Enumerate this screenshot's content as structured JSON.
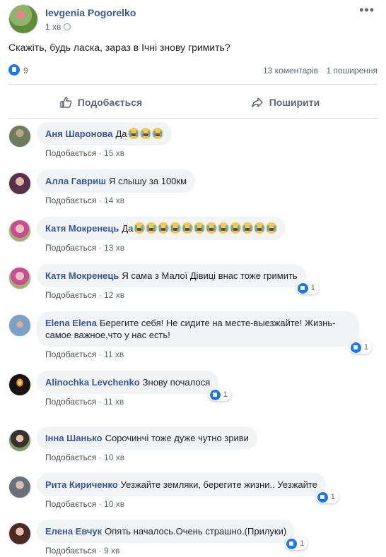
{
  "post": {
    "author": "Ievgenia Pogorelko",
    "time": "1 хв",
    "text": "Скажіть, будь ласка, зараз в Ічні знову гримить?",
    "likes": "9",
    "comments_count": "13 коментарів",
    "shares_count": "1 поширення"
  },
  "actions": {
    "like": "Подобається",
    "share": "Поширити"
  },
  "colors": {
    "accent": "#385898",
    "like_blue": "#1877f2",
    "bubble": "#f2f3f5"
  },
  "comments": [
    {
      "name": "Аня Шаронова",
      "text": "Да",
      "emoji_count": 3,
      "like_label": "Подобається",
      "time": "15 хв",
      "reactions": ""
    },
    {
      "name": "Алла Гавриш",
      "text": "Я слышу за 100км",
      "emoji_count": 0,
      "like_label": "Подобається",
      "time": "14 хв",
      "reactions": ""
    },
    {
      "name": "Катя Мокренець",
      "text": "Да",
      "emoji_count": 12,
      "like_label": "Подобається",
      "time": "13 хв",
      "reactions": ""
    },
    {
      "name": "Катя Мокренець",
      "text": "Я сама з Малої Дівиці внас тоже гримить",
      "emoji_count": 0,
      "like_label": "Подобається",
      "time": "12 хв",
      "reactions": "1"
    },
    {
      "name": "Elena Elena",
      "text": "Берегите себя! Не сидите на месте-выезжайте! Жизнь-самое важное,что у нас есть!",
      "emoji_count": 0,
      "like_label": "Подобається",
      "time": "11 хв",
      "reactions": "1"
    },
    {
      "name": "Alinochka Levchenko",
      "text": "Знову почалося",
      "emoji_count": 0,
      "like_label": "Подобається",
      "time": "11 хв",
      "reactions": "1"
    },
    {
      "name": "Інна Шанько",
      "text": "Сорочинчі тоже дуже чутно зриви",
      "emoji_count": 0,
      "like_label": "Подобається",
      "time": "10 хв",
      "reactions": ""
    },
    {
      "name": "Рита Кириченко",
      "text": "Уезжайте земляки, берегите жизни.. Уезжайте",
      "emoji_count": 0,
      "like_label": "Подобається",
      "time": "10 хв",
      "reactions": "1"
    },
    {
      "name": "Елена Евчук",
      "text": "Опять началось.Очень страшно.(Прилуки)",
      "emoji_count": 0,
      "like_label": "Подобається",
      "time": "9 хв",
      "reactions": "1"
    }
  ]
}
